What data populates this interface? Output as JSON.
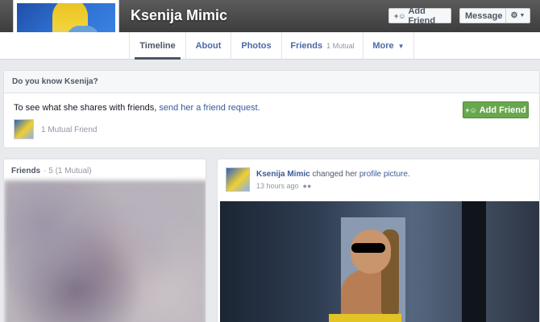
{
  "profile": {
    "name": "Ksenija Mimic"
  },
  "header_actions": {
    "add_friend_label": "Add Friend",
    "add_friend_icon": "add-friend-icon",
    "message_label": "Message",
    "settings_icon": "gear-icon"
  },
  "tabs": [
    {
      "label": "Timeline",
      "sub": ""
    },
    {
      "label": "About",
      "sub": ""
    },
    {
      "label": "Photos",
      "sub": ""
    },
    {
      "label": "Friends",
      "sub": "1 Mutual"
    },
    {
      "label": "More",
      "sub": ""
    }
  ],
  "know_card": {
    "title": "Do you know Ksenija?",
    "text_prefix": "To see what she shares with friends, ",
    "request_link": "send her a friend request.",
    "add_friend_label": "Add Friend",
    "mutual_friend": "1 Mutual Friend"
  },
  "friends_panel": {
    "title": "Friends",
    "count": "· 5 (1 Mutual)"
  },
  "post": {
    "author": "Ksenija Mimic",
    "verb": "changed her",
    "link": "profile picture.",
    "time": "13 hours ago",
    "audience_icon": "friends-audience-icon"
  },
  "colors": {
    "link": "#3b5998",
    "green_button": "#69a74e",
    "cover": "#4a4a4a",
    "background": "#e9eaed"
  }
}
